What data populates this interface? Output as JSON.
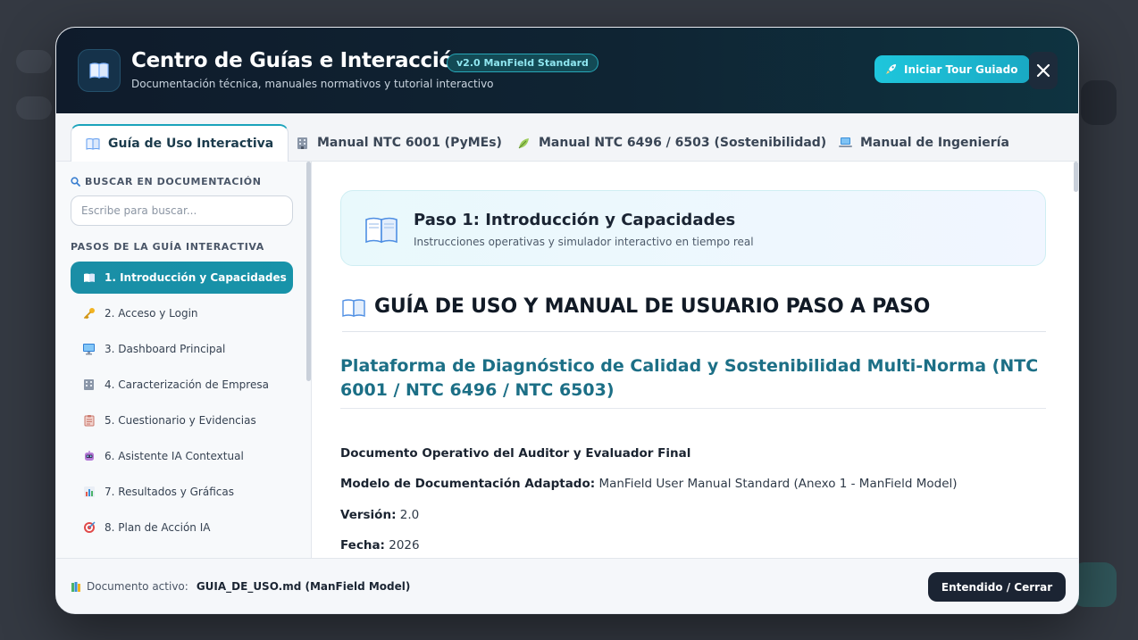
{
  "header": {
    "title": "Centro de Guías e Interacción",
    "badge": "v2.0 ManField Standard",
    "subtitle": "Documentación técnica, manuales normativos y tutorial interactivo",
    "tour_label": "Iniciar Tour Guiado",
    "close_symbol": "✕"
  },
  "tabs": [
    {
      "label": "Guía de Uso Interactiva",
      "icon": "open-book-icon",
      "active": true
    },
    {
      "label": "Manual NTC 6001 (PyMEs)",
      "icon": "building-icon",
      "active": false
    },
    {
      "label": "Manual NTC 6496 / 6503 (Sostenibilidad)",
      "icon": "leaf-icon",
      "active": false
    },
    {
      "label": "Manual de Ingeniería",
      "icon": "laptop-icon",
      "active": false
    }
  ],
  "sidebar": {
    "search_label": "BUSCAR EN DOCUMENTACIÓN",
    "search_placeholder": "Escribe para buscar...",
    "steps_label": "PASOS DE LA GUÍA INTERACTIVA",
    "items": [
      {
        "label": "1. Introducción y Capacidades",
        "icon": "open-book-icon",
        "active": true
      },
      {
        "label": "2. Acceso y Login",
        "icon": "key-icon",
        "active": false
      },
      {
        "label": "3. Dashboard Principal",
        "icon": "monitor-icon",
        "active": false
      },
      {
        "label": "4. Caracterización de Empresa",
        "icon": "building-icon",
        "active": false
      },
      {
        "label": "5. Cuestionario y Evidencias",
        "icon": "clipboard-icon",
        "active": false
      },
      {
        "label": "6. Asistente IA Contextual",
        "icon": "robot-icon",
        "active": false
      },
      {
        "label": "7. Resultados y Gráficas",
        "icon": "bar-chart-icon",
        "active": false
      },
      {
        "label": "8. Plan de Acción IA",
        "icon": "target-icon",
        "active": false
      }
    ]
  },
  "content": {
    "step_title": "Paso 1: Introducción y Capacidades",
    "step_subtitle": "Instrucciones operativas y simulador interactivo en tiempo real",
    "h1": "GUÍA DE USO Y MANUAL DE USUARIO PASO A PASO",
    "h2": "Plataforma de Diagnóstico de Calidad y Sostenibilidad Multi-Norma (NTC 6001 / NTC 6496 / NTC 6503)",
    "doc_type": "Documento Operativo del Auditor y Evaluador Final",
    "model_label": "Modelo de Documentación Adaptado:",
    "model_value": "ManField User Manual Standard (Anexo 1 - ManField Model)",
    "version_label": "Versión:",
    "version_value": "2.0",
    "date_label": "Fecha:",
    "date_value": "2026"
  },
  "footer": {
    "active_label": "Documento activo:",
    "active_file": "GUIA_DE_USO.md (ManField Model)",
    "ok_label": "Entendido / Cerrar"
  },
  "colors": {
    "accent": "#1aa3bb",
    "header_bg": "#0f1b2b",
    "heading_teal": "#1c6f86",
    "dark_button": "#1b2433"
  }
}
